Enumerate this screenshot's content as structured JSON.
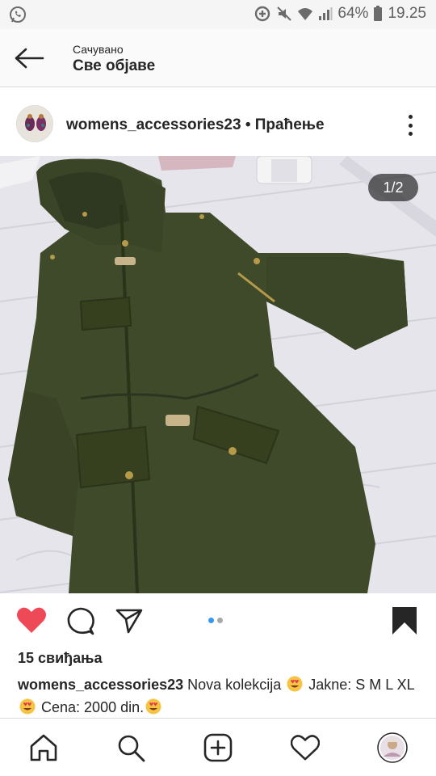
{
  "status_bar": {
    "battery": "64%",
    "time": "19.25"
  },
  "header": {
    "saved_label": "Сачувано",
    "title": "Све објаве"
  },
  "post": {
    "username": "womens_accessories23",
    "separator": " • ",
    "follow_label": "Праћење",
    "image_counter": "1/2",
    "likes": "15 свиђања",
    "caption_text_1": "Nova kolekcija",
    "caption_text_2": "Jakne: S M L XL",
    "caption_text_3": "Cena: 2000 din."
  },
  "carousel": {
    "count": 2,
    "active": 1
  },
  "icons": {
    "status_left": "whatsapp-icon",
    "back": "arrow-left-icon",
    "like": "heart-filled-icon",
    "comment": "comment-icon",
    "share": "send-icon",
    "save": "bookmark-filled-icon",
    "nav": [
      "home-icon",
      "search-icon",
      "add-post-icon",
      "heart-outline-icon",
      "profile-avatar"
    ]
  },
  "colors": {
    "like_red": "#ed4956",
    "carousel_active": "#3897f0",
    "jacket_olive": "#3f4a2a"
  }
}
